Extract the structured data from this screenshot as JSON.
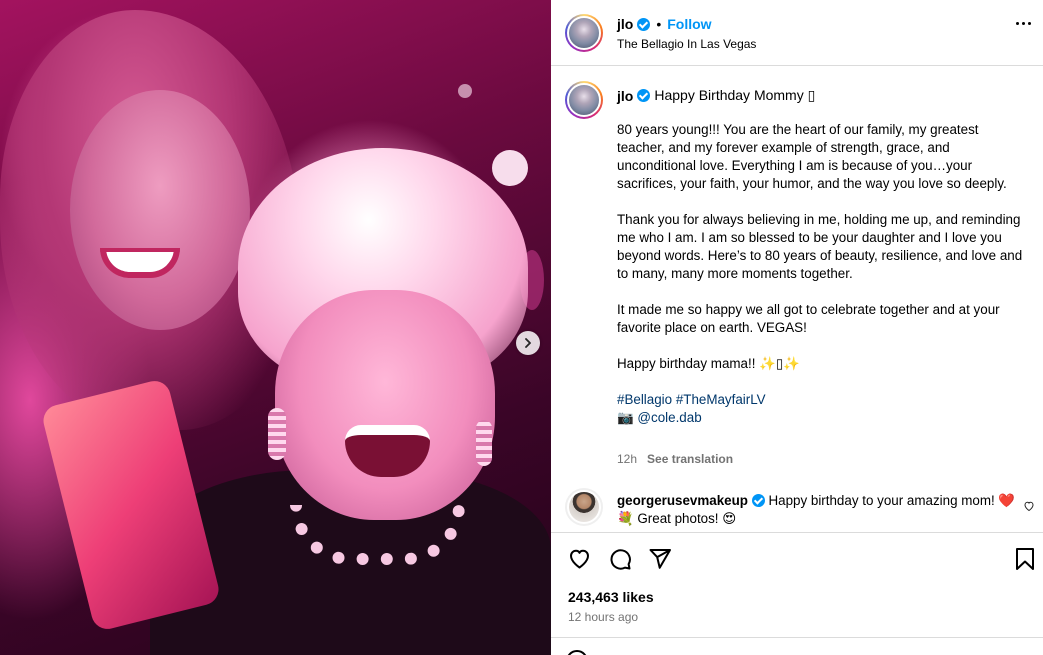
{
  "header": {
    "username": "jlo",
    "separator": "•",
    "follow_label": "Follow",
    "location": "The Bellagio In Las Vegas"
  },
  "caption": {
    "username": "jlo",
    "first_line": "Happy Birthday Mommy ▯",
    "paragraphs": [
      "80 years young!!! You are the heart of our family, my greatest teacher, and my forever example of strength, grace, and unconditional love. Everything I am is because of you…your sacrifices, your faith, your humor, and the way you love so deeply.",
      "Thank you for always believing in me, holding me up, and reminding me who I am. I am so blessed to be your daughter and I love you beyond words. Here’s to 80 years of beauty, resilience, and love and to many, many more moments together.",
      "It made me so happy we all got to celebrate together and at your favorite place on earth. VEGAS!",
      "Happy birthday mama!! ✨▯✨"
    ],
    "hashtags": "#Bellagio #TheMayfairLV",
    "camera_glyph": "📷",
    "photo_credit": "@cole.dab",
    "time": "12h",
    "see_translation": "See translation"
  },
  "comment": {
    "username": "georgerusevmakeup",
    "text": "Happy birthday to your amazing mom! ❤️💐 Great photos! 😍"
  },
  "post": {
    "likes": "243,463 likes",
    "time_ago": "12 hours ago"
  },
  "icons": {
    "verified": "verified-badge-icon",
    "more": "more-options-icon",
    "like": "heart-icon",
    "comment": "comment-bubble-icon",
    "share": "send-icon",
    "save": "bookmark-icon",
    "next": "chevron-right-icon"
  },
  "colors": {
    "accent": "#0095f6",
    "link": "#00376b",
    "muted": "#737373",
    "border": "#dbdbdb"
  }
}
